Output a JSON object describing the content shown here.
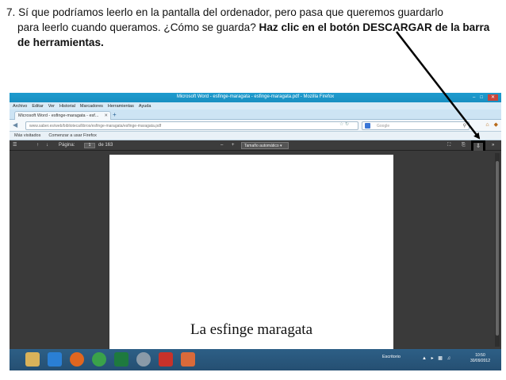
{
  "instructions": {
    "line1": "7. Sí que podríamos leerlo en la pantalla del ordenador, pero pasa que queremos guardarlo",
    "line2_plain": "para leerlo cuando queramos. ¿Cómo se guarda? ",
    "line2_bold": "Haz clic en el botón DESCARGAR de la barra",
    "line3_bold": "de herramientas."
  },
  "browser": {
    "window_title": "Microsoft Word - esfinge-maragata - esfinge-maragata.pdf - Mozilla Firefox",
    "menu": [
      "Archivo",
      "Editar",
      "Ver",
      "Historial",
      "Marcadores",
      "Herramientas",
      "Ayuda"
    ],
    "tab_label": "Microsoft Word - esfinge-maragata - esf...",
    "url": "www.saber.es/web/biblioteca/libros/esfinge-maragata/esfinge-maragata.pdf",
    "search_placeholder": "Google",
    "bookmarks": [
      "Más visitados",
      "Comenzar a usar Firefox"
    ],
    "pdf_toolbar": {
      "page_label": "Página:",
      "page_number": "1",
      "page_total": "de 163",
      "zoom_value": "Tamaño automático"
    },
    "pdf_heading": "La esfinge maragata",
    "taskbar": {
      "lang": "Escritorio",
      "clock_time": "10:50",
      "clock_date": "30/09/2012"
    }
  },
  "colors": {
    "arrow": "#000000",
    "highlight_box": "#000000"
  }
}
